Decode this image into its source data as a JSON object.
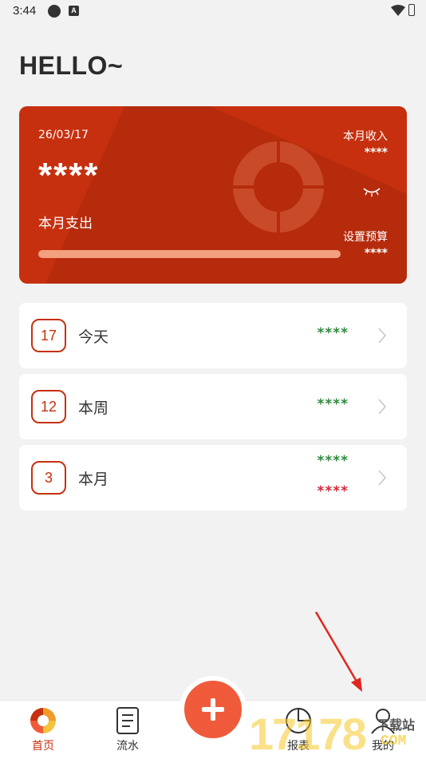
{
  "status_bar": {
    "time": "3:44",
    "badge_letter": "A"
  },
  "greeting": "HELLO~",
  "card": {
    "date": "26/03/17",
    "amount": "****",
    "expense_label": "本月支出",
    "income_label": "本月收入",
    "income_value": "****",
    "budget_label": "设置预算",
    "budget_value": "****",
    "progress_fraction": 0.78
  },
  "summary": [
    {
      "day": "17",
      "label": "今天",
      "value": "****"
    },
    {
      "day": "12",
      "label": "本周",
      "value": "****"
    },
    {
      "day": "3",
      "label": "本月",
      "income": "****",
      "expense": "****"
    }
  ],
  "tabbar": {
    "tabs": [
      {
        "label": "首页",
        "icon": "donut-chart-icon"
      },
      {
        "label": "流水",
        "icon": "document-icon"
      },
      {
        "label": "报表",
        "icon": "report-icon"
      },
      {
        "label": "我的",
        "icon": "person-icon"
      }
    ],
    "add_icon": "plus-icon"
  },
  "watermark": {
    "digits": "17178",
    "top": "下载站",
    "bottom": "COM"
  },
  "colors": {
    "accent": "#c6300f",
    "fab": "#ef5b3a",
    "green": "#2e8b3d",
    "red": "#d3283a"
  }
}
